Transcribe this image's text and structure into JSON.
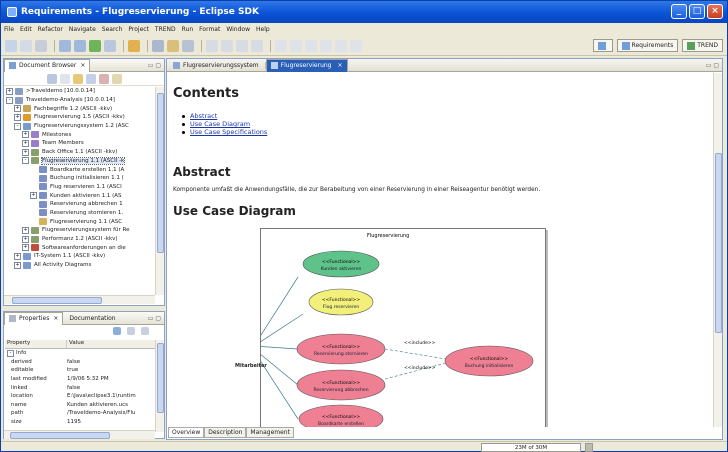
{
  "window": {
    "title": "Requirements - Flugreservierung - Eclipse SDK"
  },
  "menu": [
    "File",
    "Edit",
    "Refactor",
    "Navigate",
    "Search",
    "Project",
    "TREND",
    "Run",
    "Format",
    "Window",
    "Help"
  ],
  "perspectives": [
    "Requirements",
    "TREND"
  ],
  "document_browser": {
    "tab_label": "Document Browser",
    "tree": [
      {
        "label": ">Traveldemo  [10.0.0.14]",
        "depth": 0,
        "exp": "+",
        "color": "#8a9cc0"
      },
      {
        "label": "Traveldemo-Analysis  [10.0.0.14]",
        "depth": 0,
        "exp": "-",
        "color": "#8a9cc0"
      },
      {
        "label": "Fachbegriffe  1.2  (ASCII -kkv)",
        "depth": 1,
        "exp": "+",
        "color": "#c9a557"
      },
      {
        "label": "Flugreservierung  1.5  (ASCII -kkv)",
        "depth": 1,
        "exp": "+",
        "color": "#e09a2a"
      },
      {
        "label": "Flugreservierungssystem  1.2  (ASC",
        "depth": 1,
        "exp": "-",
        "color": "#7a9ad0"
      },
      {
        "label": "Milestones",
        "depth": 2,
        "exp": "+",
        "color": "#9c7dc9"
      },
      {
        "label": "Team Members",
        "depth": 2,
        "exp": "+",
        "color": "#9c7dc9"
      },
      {
        "label": "Back Office  1.1  (ASCII -kkv)",
        "depth": 2,
        "exp": "+",
        "color": "#8aa06a"
      },
      {
        "label": "Flugreservierung  1.1  (ASCII -k",
        "depth": 2,
        "exp": "-",
        "color": "#8aa06a",
        "sel": true
      },
      {
        "label": "Boardkarte erstellen  1.1  (A",
        "depth": 3,
        "exp": "",
        "color": "#7a8fc4"
      },
      {
        "label": "Buchung initialisieren  1.1  (",
        "depth": 3,
        "exp": "",
        "color": "#7a8fc4"
      },
      {
        "label": "Flug reservieren  1.1  (ASCI",
        "depth": 3,
        "exp": "",
        "color": "#7a8fc4"
      },
      {
        "label": "Kunden aktivieren  1.1  (AS",
        "depth": 3,
        "exp": "+",
        "color": "#7a8fc4"
      },
      {
        "label": "Reservierung abbrechen  1",
        "depth": 3,
        "exp": "",
        "color": "#7a8fc4"
      },
      {
        "label": "Reservierung stornieren  1.",
        "depth": 3,
        "exp": "",
        "color": "#7a8fc4"
      },
      {
        "label": "Flugreservierung  1.1  (ASC",
        "depth": 3,
        "exp": "",
        "color": "#d6b35a"
      },
      {
        "label": "Flugreservierungssystem für Re",
        "depth": 2,
        "exp": "+",
        "color": "#8aa06a"
      },
      {
        "label": "Performanz  1.2  (ASCII -kkv)",
        "depth": 2,
        "exp": "+",
        "color": "#8aa06a"
      },
      {
        "label": "Softwareanforderungen an die",
        "depth": 2,
        "exp": "+",
        "color": "#c44b3a"
      },
      {
        "label": "IT-System  1.1  (ASCII -kkv)",
        "depth": 1,
        "exp": "+",
        "color": "#7a9ad0"
      },
      {
        "label": "All Activity Diagrams",
        "depth": 1,
        "exp": "+",
        "color": "#7a9ad0"
      }
    ]
  },
  "properties": {
    "tab_label": "Properties",
    "tab2_label": "Documentation",
    "col_property": "Property",
    "col_value": "Value",
    "group": "Info",
    "rows": [
      {
        "k": "derived",
        "v": "false"
      },
      {
        "k": "editable",
        "v": "true"
      },
      {
        "k": "last modified",
        "v": "1/9/06 5:32 PM"
      },
      {
        "k": "linked",
        "v": "false"
      },
      {
        "k": "location",
        "v": "E:\\Java\\eclipse3.1\\runtim"
      },
      {
        "k": "name",
        "v": "Kunden aktivieren.ucs"
      },
      {
        "k": "path",
        "v": "/Traveldemo-Analysis/Flu"
      },
      {
        "k": "size",
        "v": "1195"
      }
    ]
  },
  "editor": {
    "tabs": [
      "Flugreservierungssystem",
      "Flugreservierung"
    ],
    "contents_heading": "Contents",
    "toc": [
      "Abstract",
      "Use Case Diagram",
      "Use Case Specifications"
    ],
    "abstract_heading": "Abstract",
    "abstract_text": "Komponente umfaßt die Anwendungsfälle, die zur Berabeitung von einer Reservierung in einer Reiseagentur benötigt werden.",
    "usecase_heading": "Use Case Diagram",
    "bottom_tabs": [
      "Overview",
      "Description",
      "Management"
    ]
  },
  "diagram": {
    "title": "Flugreservierung",
    "actor": "Mitarbeiter",
    "stereotype": "<<Functional>>",
    "include": "<<include>>",
    "usecases": [
      {
        "name": "Kunden aktivieren",
        "color": "#5fc28a"
      },
      {
        "name": "Flug reservieren",
        "color": "#f2ef7a"
      },
      {
        "name": "Reservierung stornieren",
        "color": "#ef7f93"
      },
      {
        "name": "Reservierung abbrechen",
        "color": "#ef7f93"
      },
      {
        "name": "Boardkarte erstellen",
        "color": "#ef7f93"
      },
      {
        "name": "Buchung initialisieren",
        "color": "#ef7f93"
      }
    ]
  },
  "status": {
    "memory": "23M of 30M"
  }
}
